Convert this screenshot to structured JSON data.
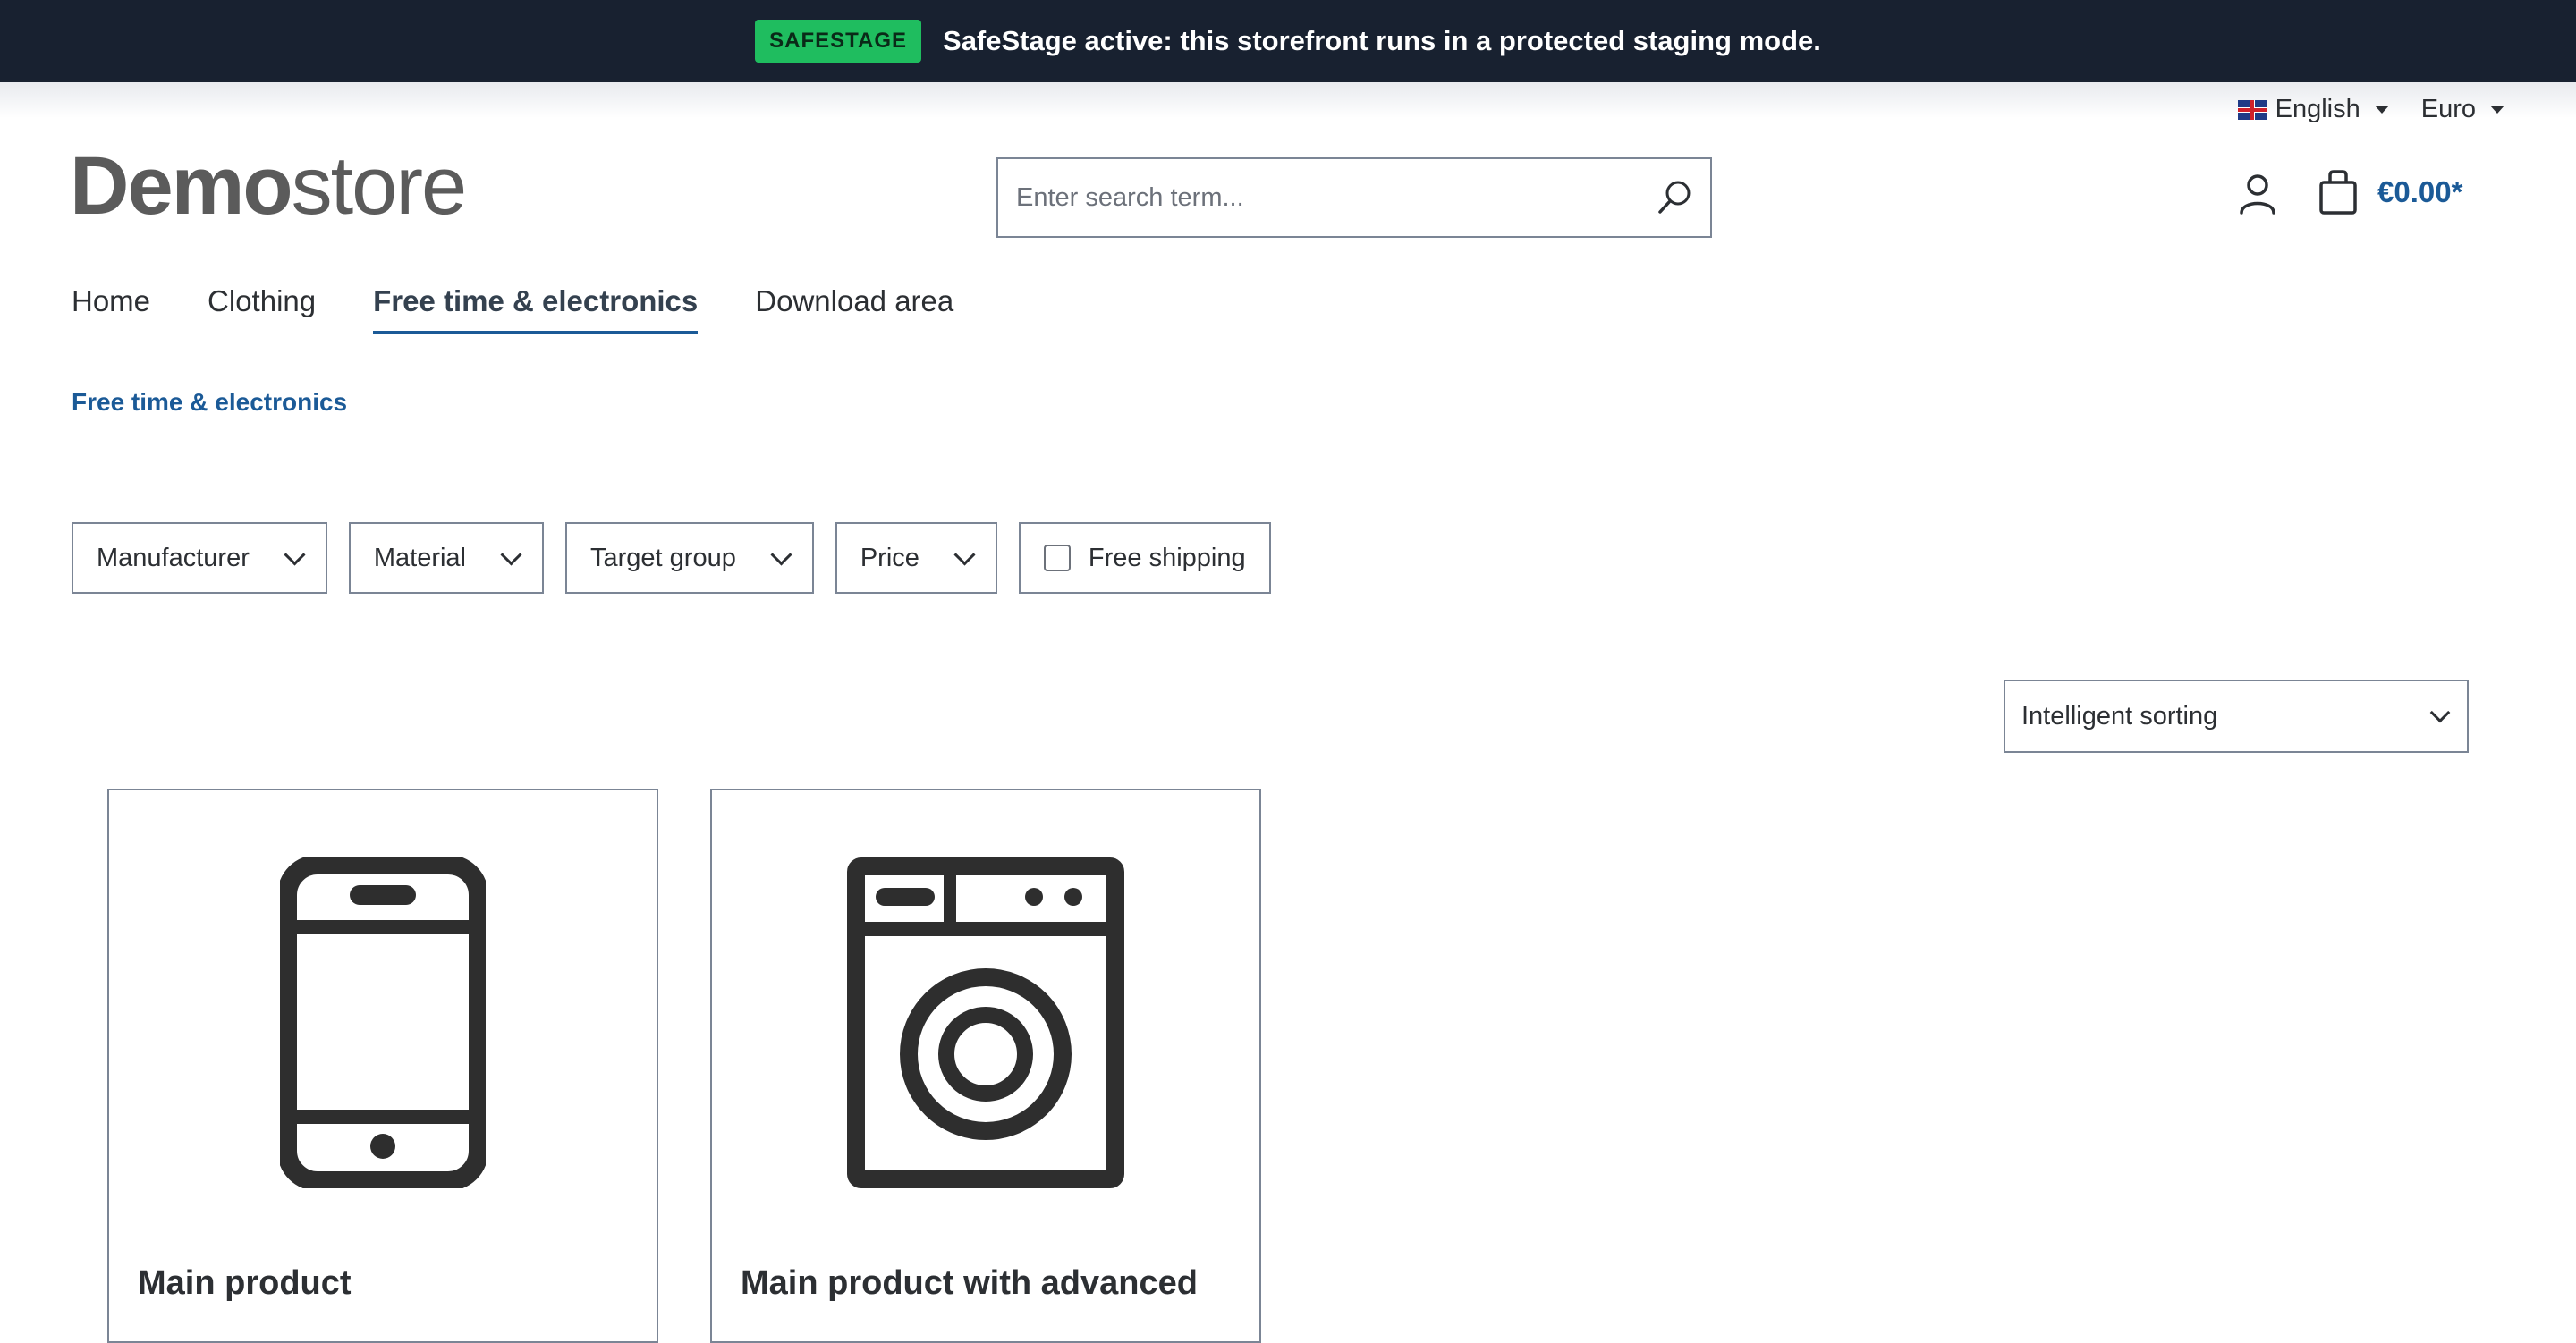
{
  "banner": {
    "badge": "SAFESTAGE",
    "message": "SafeStage active: this storefront runs in a protected staging mode.",
    "badge_color": "#1fbd5f",
    "background_color": "#182130"
  },
  "topbar": {
    "language": "English",
    "language_icon": "uk-flag-icon",
    "currency": "Euro"
  },
  "logo": {
    "bold": "Demo",
    "light": "store"
  },
  "search": {
    "placeholder": "Enter search term...",
    "value": ""
  },
  "header": {
    "account_icon": "user-icon",
    "cart_icon": "shopping-bag-icon",
    "cart_total": "€0.00*",
    "accent_color": "#1b5a97"
  },
  "nav": {
    "items": [
      {
        "label": "Home",
        "active": false
      },
      {
        "label": "Clothing",
        "active": false
      },
      {
        "label": "Free time & electronics",
        "active": true
      },
      {
        "label": "Download area",
        "active": false
      }
    ]
  },
  "breadcrumb": {
    "current": "Free time & electronics"
  },
  "filters": {
    "manufacturer": "Manufacturer",
    "material": "Material",
    "target_group": "Target group",
    "price": "Price",
    "free_shipping": "Free shipping"
  },
  "sorting": {
    "selected": "Intelligent sorting"
  },
  "products": [
    {
      "title": "Main product",
      "icon": "smartphone-icon"
    },
    {
      "title": "Main product with advanced",
      "icon": "washing-machine-icon"
    }
  ]
}
